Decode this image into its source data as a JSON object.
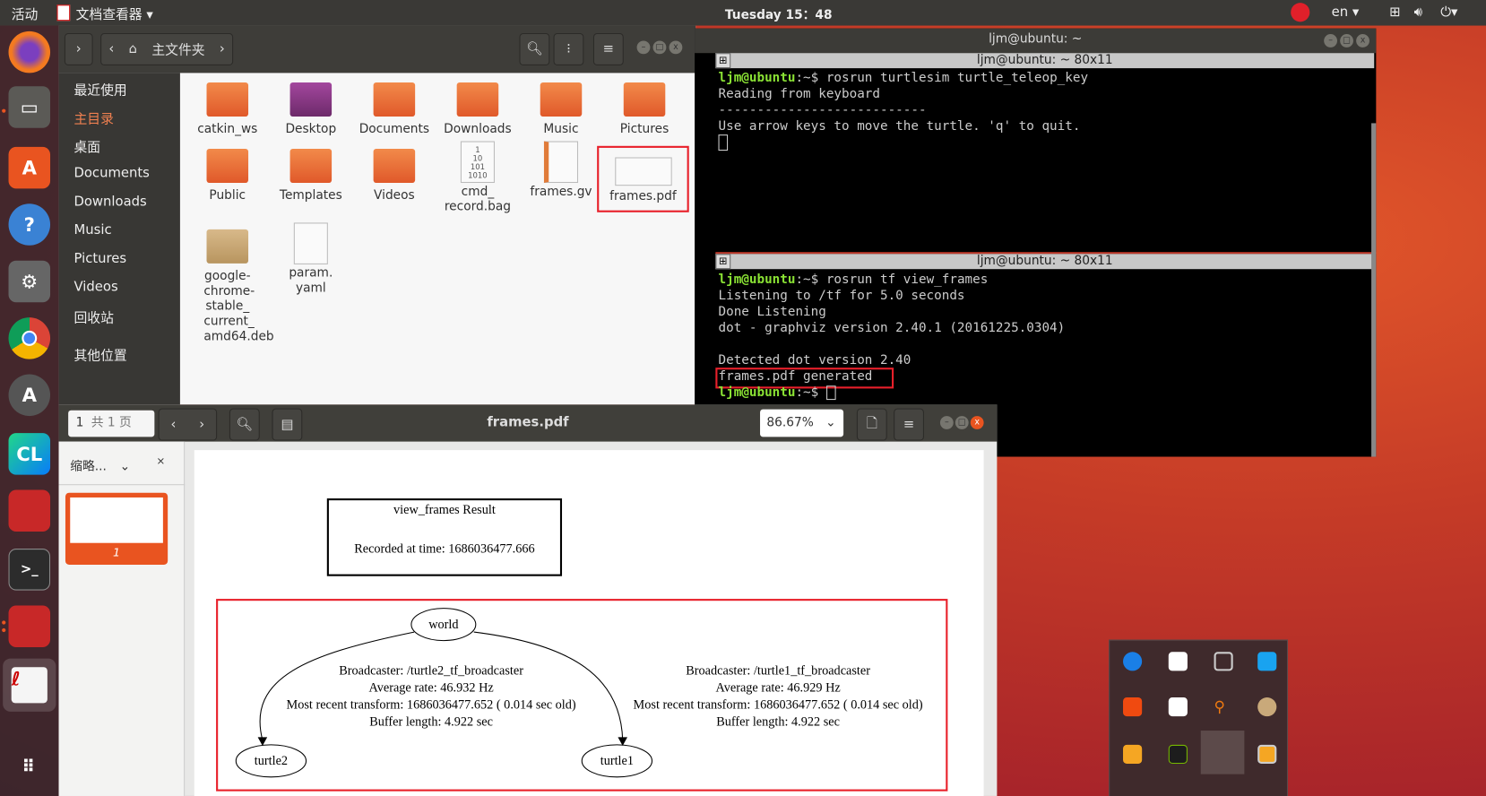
{
  "topbar": {
    "activities": "活动",
    "app_menu": "文档查看器 ▾",
    "clock": "Tuesday 15：48",
    "lang": "en ▾"
  },
  "dock": {
    "items": [
      "firefox",
      "files",
      "ubuntu-software",
      "help",
      "settings",
      "chrome",
      "software-updater",
      "clion",
      "terminal-multi",
      "terminal",
      "terminal-multi-2",
      "document-viewer",
      "show-apps"
    ]
  },
  "file_manager": {
    "location": "主文件夹",
    "sidebar": [
      "最近使用",
      "主目录",
      "桌面",
      "Documents",
      "Downloads",
      "Music",
      "Pictures",
      "Videos",
      "回收站",
      "其他位置"
    ],
    "files": [
      "catkin_ws",
      "Desktop",
      "Documents",
      "Downloads",
      "Music",
      "Pictures",
      "Public",
      "Templates",
      "Videos",
      "cmd_ record.bag",
      "frames.gv",
      "frames.pdf",
      "google- chrome- stable_ current_ amd64.deb",
      "param. yaml"
    ],
    "bag_icon_text": "1\n10\n101\n1010"
  },
  "terminal": {
    "title": "ljm@ubuntu: ~",
    "pane1_title": "ljm@ubuntu: ~ 80x11",
    "pane2_title": "ljm@ubuntu: ~ 80x11",
    "prompt_user": "ljm@ubuntu",
    "prompt_path": ":~$ ",
    "pane1": {
      "cmd": "rosrun turtlesim turtle_teleop_key",
      "lines": [
        "Reading from keyboard",
        "---------------------------",
        "Use arrow keys to move the turtle. 'q' to quit."
      ]
    },
    "pane2": {
      "cmd": "rosrun tf view_frames",
      "lines": [
        "Listening to /tf for 5.0 seconds",
        "Done Listening",
        "dot - graphviz version 2.40.1 (20161225.0304)",
        "",
        "Detected dot version 2.40",
        "frames.pdf generated"
      ]
    }
  },
  "pdf_viewer": {
    "page": "1",
    "page_total": "共 1 页",
    "title": "frames.pdf",
    "zoom": "86.67%",
    "sidebar_label": "缩略...",
    "thumb_label": "1",
    "doc": {
      "title": "view_frames Result",
      "recorded": "Recorded at time: 1686036477.666",
      "nodes": [
        "world",
        "turtle2",
        "turtle1"
      ],
      "edge_left": [
        "Broadcaster: /turtle2_tf_broadcaster",
        "Average rate: 46.932 Hz",
        "Most recent transform: 1686036477.652 ( 0.014 sec old)",
        "Buffer length: 4.922 sec"
      ],
      "edge_right": [
        "Broadcaster: /turtle1_tf_broadcaster",
        "Average rate: 46.929 Hz",
        "Most recent transform: 1686036477.652 ( 0.014 sec old)",
        "Buffer length: 4.922 sec"
      ]
    }
  },
  "colors": {
    "accent": "#e95420",
    "highlight": "#e8202a",
    "prompt": "#8ae234"
  }
}
